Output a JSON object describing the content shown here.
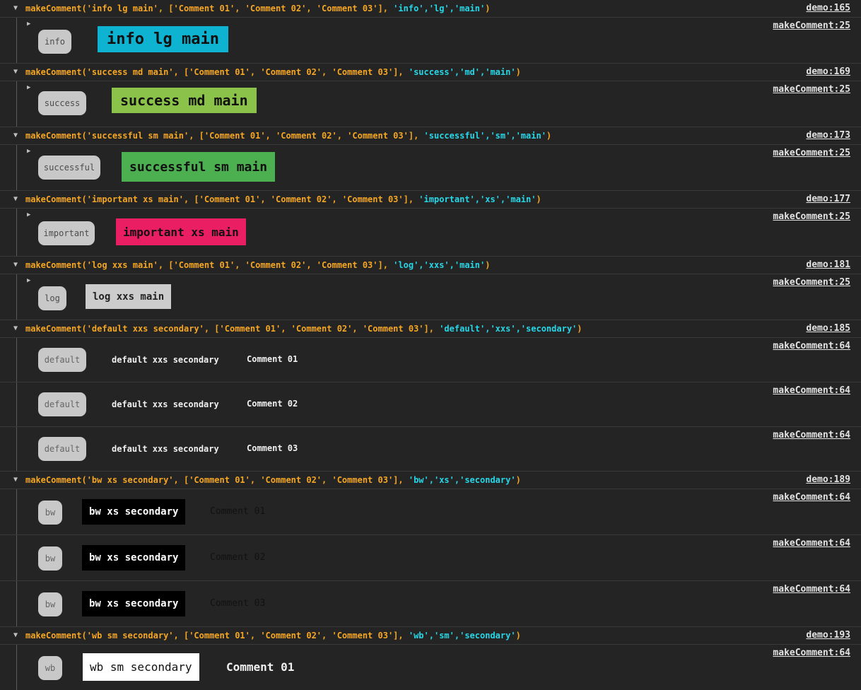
{
  "groups": [
    {
      "call_prefix": "makeComment('info lg main', ['Comment 01', 'Comment 02', 'Comment 03'], ",
      "call_args": "'info','lg','main'",
      "call_suffix": ")",
      "source": "demo:165",
      "rows": [
        {
          "source": "makeComment:25",
          "pill": "info",
          "label": "info lg main"
        }
      ]
    },
    {
      "call_prefix": "makeComment('success md main', ['Comment 01', 'Comment 02', 'Comment 03'], ",
      "call_args": "'success','md','main'",
      "call_suffix": ")",
      "source": "demo:169",
      "rows": [
        {
          "source": "makeComment:25",
          "pill": "success",
          "label": "success md main"
        }
      ]
    },
    {
      "call_prefix": "makeComment('successful sm main', ['Comment 01', 'Comment 02', 'Comment 03'], ",
      "call_args": "'successful','sm','main'",
      "call_suffix": ")",
      "source": "demo:173",
      "rows": [
        {
          "source": "makeComment:25",
          "pill": "successful",
          "label": "successful sm main"
        }
      ]
    },
    {
      "call_prefix": "makeComment('important xs main', ['Comment 01', 'Comment 02', 'Comment 03'], ",
      "call_args": "'important','xs','main'",
      "call_suffix": ")",
      "source": "demo:177",
      "rows": [
        {
          "source": "makeComment:25",
          "pill": "important",
          "label": "important xs main"
        }
      ]
    },
    {
      "call_prefix": "makeComment('log xxs main', ['Comment 01', 'Comment 02', 'Comment 03'], ",
      "call_args": "'log','xxs','main'",
      "call_suffix": ")",
      "source": "demo:181",
      "rows": [
        {
          "source": "makeComment:25",
          "pill": "log",
          "label": "log xxs main"
        }
      ]
    },
    {
      "call_prefix": "makeComment('default xxs secondary', ['Comment 01', 'Comment 02', 'Comment 03'], ",
      "call_args": "'default','xxs','secondary'",
      "call_suffix": ")",
      "source": "demo:185",
      "rows": [
        {
          "source": "makeComment:64",
          "pill": "default",
          "label": "default xxs secondary",
          "comment": "Comment 01"
        },
        {
          "source": "makeComment:64",
          "pill": "default",
          "label": "default xxs secondary",
          "comment": "Comment 02"
        },
        {
          "source": "makeComment:64",
          "pill": "default",
          "label": "default xxs secondary",
          "comment": "Comment 03"
        }
      ]
    },
    {
      "call_prefix": "makeComment('bw xs secondary', ['Comment 01', 'Comment 02', 'Comment 03'], ",
      "call_args": "'bw','xs','secondary'",
      "call_suffix": ")",
      "source": "demo:189",
      "rows": [
        {
          "source": "makeComment:64",
          "pill": "bw",
          "label": "bw xs secondary",
          "comment": "Comment 01"
        },
        {
          "source": "makeComment:64",
          "pill": "bw",
          "label": "bw xs secondary",
          "comment": "Comment 02"
        },
        {
          "source": "makeComment:64",
          "pill": "bw",
          "label": "bw xs secondary",
          "comment": "Comment 03"
        }
      ]
    },
    {
      "call_prefix": "makeComment('wb sm secondary', ['Comment 01', 'Comment 02', 'Comment 03'], ",
      "call_args": "'wb','sm','secondary'",
      "call_suffix": ")",
      "source": "demo:193",
      "rows": [
        {
          "source": "makeComment:64",
          "pill": "wb",
          "label": "wb sm secondary",
          "comment": "Comment 01"
        }
      ]
    }
  ],
  "icons": {
    "expanded": "▼",
    "collapsed": "▶"
  },
  "colors": {
    "info": "#0fb3d2",
    "success": "#8bc34a",
    "successful": "#4caf50",
    "important": "#e91e63",
    "log": "#cccccc",
    "bw_bg": "#000000",
    "wb_bg": "#ffffff",
    "call": "#f5a623",
    "args": "#26d7e8"
  }
}
